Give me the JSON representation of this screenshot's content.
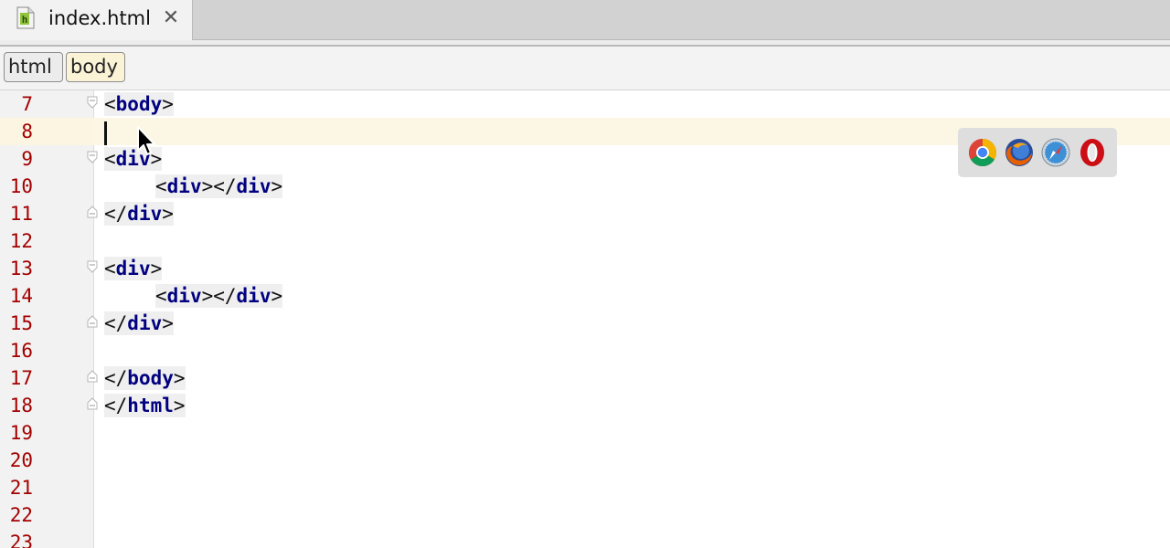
{
  "tab": {
    "title": "index.html",
    "icon": "html-file-icon",
    "close_glyph": "✕"
  },
  "breadcrumb": {
    "items": [
      "html",
      "body"
    ]
  },
  "editor": {
    "current_line": 8,
    "lines": [
      {
        "num": "7",
        "code": "<body>"
      },
      {
        "num": "8",
        "code": ""
      },
      {
        "num": "9",
        "code": "<div>"
      },
      {
        "num": "10",
        "code": "    <div></div>"
      },
      {
        "num": "11",
        "code": "</div>"
      },
      {
        "num": "12",
        "code": ""
      },
      {
        "num": "13",
        "code": "<div>"
      },
      {
        "num": "14",
        "code": "    <div></div>"
      },
      {
        "num": "15",
        "code": "</div>"
      },
      {
        "num": "16",
        "code": ""
      },
      {
        "num": "17",
        "code": "</body>"
      },
      {
        "num": "18",
        "code": "</html>"
      },
      {
        "num": "19",
        "code": ""
      },
      {
        "num": "20",
        "code": ""
      },
      {
        "num": "21",
        "code": ""
      },
      {
        "num": "22",
        "code": ""
      },
      {
        "num": "23",
        "code": ""
      }
    ]
  },
  "browsers": [
    {
      "name": "Chrome",
      "icon": "chrome-icon"
    },
    {
      "name": "Firefox",
      "icon": "firefox-icon"
    },
    {
      "name": "Safari",
      "icon": "safari-icon"
    },
    {
      "name": "Opera",
      "icon": "opera-icon"
    }
  ],
  "colors": {
    "line_number": "#a40000",
    "tag_name": "#000080",
    "current_line_bg": "#fcf7e4",
    "breadcrumb_active_bg": "#fbf3d5"
  }
}
